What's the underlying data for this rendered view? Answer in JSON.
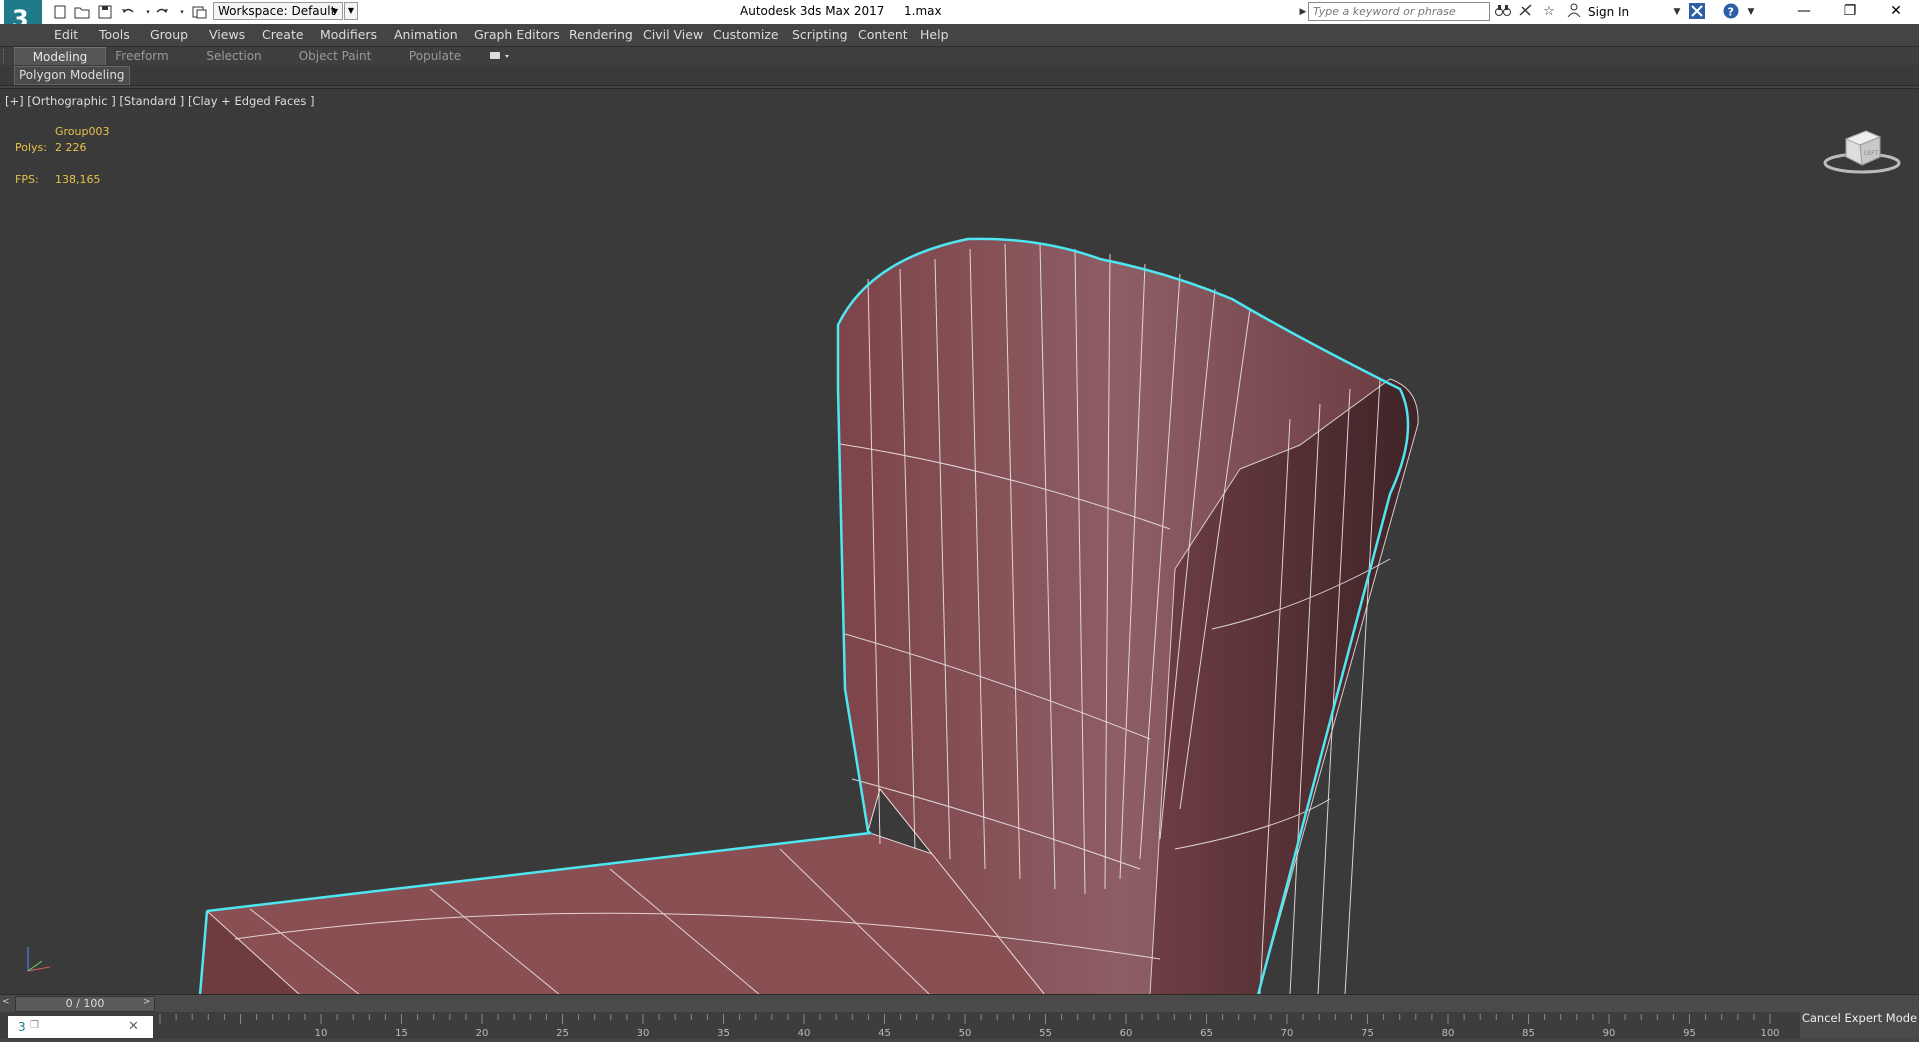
{
  "title": {
    "app": "Autodesk 3ds Max 2017",
    "file": "1.max",
    "workspace": "Workspace: Default",
    "search_placeholder": "Type a keyword or phrase",
    "sign_in": "Sign In"
  },
  "menu": [
    "Edit",
    "Tools",
    "Group",
    "Views",
    "Create",
    "Modifiers",
    "Animation",
    "Graph Editors",
    "Rendering",
    "Civil View",
    "Customize",
    "Scripting",
    "Content",
    "Help"
  ],
  "ribbon": {
    "tabs": [
      "Modeling",
      "Freeform",
      "Selection",
      "Object Paint",
      "Populate"
    ],
    "active_tab": "Modeling",
    "panel": "Polygon Modeling"
  },
  "viewport": {
    "label": "[+] [Orthographic ] [Standard ] [Clay + Edged Faces ]",
    "object_name": "Group003",
    "polys_label": "Polys:",
    "polys_value": "2 226",
    "fps_label": "FPS:",
    "fps_value": "138,165",
    "viewcube_face": "LEFT"
  },
  "timeline": {
    "frame": "0 / 100",
    "ticks": [
      "10",
      "15",
      "20",
      "25",
      "30",
      "35",
      "40",
      "45",
      "50",
      "55",
      "60",
      "65",
      "70",
      "75",
      "80",
      "85",
      "90",
      "95",
      "100"
    ]
  },
  "status": {
    "cancel_expert": "Cancel Expert Mode"
  },
  "colors": {
    "selection_outline": "#4ee6f0",
    "mesh_fill": "#8a4f52",
    "viewport_bg": "#3a3a3a",
    "stat_text": "#e8c24a"
  }
}
